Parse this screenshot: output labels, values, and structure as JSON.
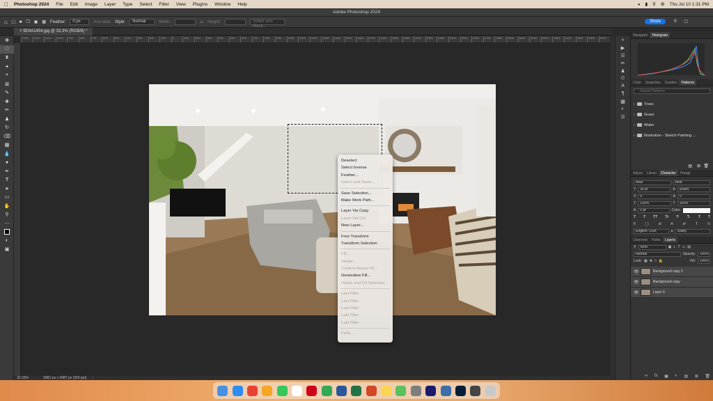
{
  "menubar": {
    "app": "Photoshop 2024",
    "items": [
      "File",
      "Edit",
      "Image",
      "Layer",
      "Type",
      "Select",
      "Filter",
      "View",
      "Plugins",
      "Window",
      "Help"
    ],
    "clock": "Thu Jul 10  1:31 PM"
  },
  "window": {
    "title": "Adobe Photoshop 2024"
  },
  "options": {
    "feather_label": "Feather:",
    "feather_value": "0 px",
    "antialias": "Anti-alias",
    "style_label": "Style:",
    "style_value": "Normal",
    "width_label": "Width:",
    "height_label": "Height:",
    "select_mask": "Select and Mask...",
    "share": "Share"
  },
  "document": {
    "tab_title": "9D4A1454.jpg @ 33.3% (RGB/8) *",
    "zoom": "33.33%",
    "dimensions": "5881 px x 3987 px (300 ppi)"
  },
  "ruler": {
    "ticks": [
      "1300",
      "1200",
      "1100",
      "1000",
      "900",
      "800",
      "700",
      "600",
      "500",
      "400",
      "300",
      "200",
      "100",
      "0",
      "100",
      "200",
      "300",
      "400",
      "500",
      "600",
      "700",
      "800",
      "900",
      "1000",
      "1100",
      "1200",
      "1300",
      "1400",
      "1500",
      "1600",
      "1700",
      "1800",
      "1900",
      "2000",
      "2100",
      "2200",
      "2300",
      "2400",
      "2500",
      "2600",
      "2700",
      "2800",
      "2900",
      "3000",
      "3100",
      "3200",
      "3300",
      "3400",
      "3500",
      "3600",
      "3700",
      "3800",
      "3900",
      "4000",
      "4100",
      "4200",
      "4300",
      "4400",
      "4500",
      "4600",
      "4700",
      "4800",
      "4900",
      "5000",
      "5100",
      "5200",
      "5300",
      "5400",
      "5500",
      "5600",
      "5700"
    ]
  },
  "context_menu": [
    {
      "label": "Deselect",
      "enabled": true
    },
    {
      "label": "Select Inverse",
      "enabled": true
    },
    {
      "label": "Feather...",
      "enabled": true
    },
    {
      "label": "Select and Mask...",
      "enabled": false
    },
    {
      "sep": true
    },
    {
      "label": "Save Selection...",
      "enabled": true
    },
    {
      "label": "Make Work Path...",
      "enabled": true
    },
    {
      "sep": true
    },
    {
      "label": "Layer Via Copy",
      "enabled": true
    },
    {
      "label": "Layer Via Cut",
      "enabled": false
    },
    {
      "label": "New Layer...",
      "enabled": true
    },
    {
      "sep": true
    },
    {
      "label": "Free Transform",
      "enabled": true
    },
    {
      "label": "Transform Selection",
      "enabled": true
    },
    {
      "sep": true
    },
    {
      "label": "Fill...",
      "enabled": false
    },
    {
      "label": "Stroke...",
      "enabled": false
    },
    {
      "label": "Content-Aware Fill...",
      "enabled": false
    },
    {
      "label": "Generative Fill...",
      "enabled": true
    },
    {
      "label": "Delete and Fill Selection",
      "enabled": false
    },
    {
      "sep": true
    },
    {
      "label": "Last Filter",
      "enabled": false
    },
    {
      "label": "Last Filter",
      "enabled": false
    },
    {
      "label": "Last Filter",
      "enabled": false
    },
    {
      "label": "Last Filter",
      "enabled": false
    },
    {
      "label": "Last Filter",
      "enabled": false
    },
    {
      "sep": true
    },
    {
      "label": "Fade...",
      "enabled": false
    }
  ],
  "panels": {
    "nav_tabs": [
      "Navigator",
      "Histogram"
    ],
    "pattern_tabs": [
      "Color",
      "Swatches",
      "Gradien",
      "Patterns"
    ],
    "pattern_search": "Search Patterns",
    "patterns": [
      "Trees",
      "Grass",
      "Water",
      "Illustration - Sketch Painting ..."
    ],
    "char_tabs": [
      "Adjust",
      "Librari",
      "Character",
      "Paragr."
    ],
    "character": {
      "font": "Arial",
      "style": "Bold",
      "size": "38 pt",
      "leading": "(Auto)",
      "kerning": "0",
      "tracking": "0",
      "vscale": "100%",
      "hscale": "100%",
      "baseline": "0 pt",
      "color_label": "Color:",
      "language": "English: USA",
      "aa": "Sharp"
    },
    "layer_tabs": [
      "Channels",
      "Paths",
      "Layers"
    ],
    "layers_ctrl": {
      "kind": "Kind",
      "blend": "Normal",
      "opacity_label": "Opacity:",
      "opacity": "100%",
      "lock_label": "Lock:",
      "fill_label": "Fill:",
      "fill": "100%"
    },
    "layers": [
      "Background copy 2",
      "Background copy",
      "Layer 0"
    ]
  },
  "dock": [
    "Finder",
    "Safari",
    "Chrome",
    "Photos",
    "FaceTime",
    "Calendar",
    "Acrobat",
    "Chrome",
    "Word",
    "Excel",
    "PowerPoint",
    "Notes",
    "Maps",
    "Calculator",
    "WD",
    "QuickTime",
    "Ps",
    "Screen",
    "Trash"
  ]
}
